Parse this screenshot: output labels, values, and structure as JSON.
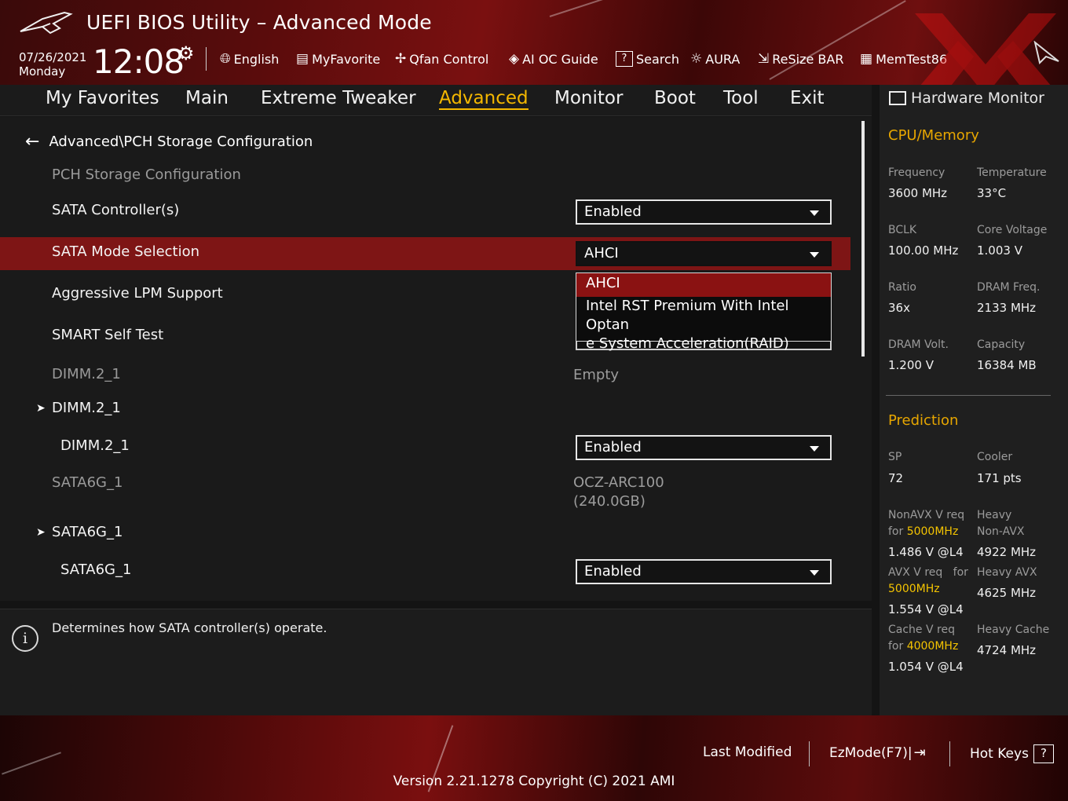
{
  "app": {
    "title": "UEFI BIOS Utility – Advanced Mode",
    "date": "07/26/2021",
    "day": "Monday",
    "time": "12:08"
  },
  "toolbar": [
    {
      "label": "English",
      "icon": "globe-icon"
    },
    {
      "label": "MyFavorite",
      "icon": "favorite-icon"
    },
    {
      "label": "Qfan Control",
      "icon": "fan-icon"
    },
    {
      "label": "AI OC Guide",
      "icon": "ai-guide-icon"
    },
    {
      "label": "Search",
      "icon": "search-icon"
    },
    {
      "label": "AURA",
      "icon": "aura-icon"
    },
    {
      "label": "ReSize BAR",
      "icon": "resize-bar-icon"
    },
    {
      "label": "MemTest86",
      "icon": "memtest-icon"
    }
  ],
  "tabs": [
    "My Favorites",
    "Main",
    "Extreme Tweaker",
    "Advanced",
    "Monitor",
    "Boot",
    "Tool",
    "Exit"
  ],
  "active_tab": "Advanced",
  "breadcrumb": "Advanced\\PCH Storage Configuration",
  "settings": {
    "section_title": "PCH Storage Configuration",
    "sata_controllers": {
      "label": "SATA Controller(s)",
      "value": "Enabled"
    },
    "sata_mode": {
      "label": "SATA Mode Selection",
      "value": "AHCI"
    },
    "aggressive_lpm": {
      "label": "Aggressive LPM Support"
    },
    "smart_self_test": {
      "label": "SMART Self Test"
    },
    "dimm_info": {
      "label": "DIMM.2_1",
      "value": "Empty"
    },
    "dimm_group": {
      "label": "DIMM.2_1"
    },
    "dimm_port": {
      "label": "DIMM.2_1",
      "value": "Enabled"
    },
    "sata_info": {
      "label": "SATA6G_1",
      "value_line1": "OCZ-ARC100",
      "value_line2": "(240.0GB)"
    },
    "sata_group": {
      "label": "SATA6G_1"
    },
    "sata_port": {
      "label": "SATA6G_1",
      "value": "Enabled"
    }
  },
  "dropdown_options": {
    "option1": "AHCI",
    "option2_line1": "Intel RST Premium With Intel Optan",
    "option2_line2": "e System Acceleration(RAID)"
  },
  "help_text": "Determines how SATA controller(s) operate.",
  "hw_monitor": {
    "title": "Hardware Monitor",
    "cpu_memory": {
      "title": "CPU/Memory",
      "frequency": {
        "label": "Frequency",
        "value": "3600 MHz"
      },
      "temperature": {
        "label": "Temperature",
        "value": "33°C"
      },
      "bclk": {
        "label": "BCLK",
        "value": "100.00 MHz"
      },
      "core_voltage": {
        "label": "Core Voltage",
        "value": "1.003 V"
      },
      "ratio": {
        "label": "Ratio",
        "value": "36x"
      },
      "dram_freq": {
        "label": "DRAM Freq.",
        "value": "2133 MHz"
      },
      "dram_volt": {
        "label": "DRAM Volt.",
        "value": "1.200 V"
      },
      "capacity": {
        "label": "Capacity",
        "value": "16384 MB"
      }
    },
    "prediction": {
      "title": "Prediction",
      "sp": {
        "label": "SP",
        "value": "72"
      },
      "cooler": {
        "label": "Cooler",
        "value": "171 pts"
      },
      "nonavx": {
        "label1": "NonAVX V req",
        "label2": "for",
        "freq": "5000MHz",
        "value": "1.486 V @L4"
      },
      "heavy_nonavx": {
        "label1": "Heavy",
        "label2": "Non-AVX",
        "value": "4922 MHz"
      },
      "avx": {
        "label1": "AVX V req",
        "label_for": "for",
        "freq": "5000MHz",
        "value": "1.554 V @L4"
      },
      "heavy_avx": {
        "label": "Heavy AVX",
        "value": "4625 MHz"
      },
      "cache": {
        "label1": "Cache V req",
        "label2": "for",
        "freq": "4000MHz",
        "value": "1.054 V @L4"
      },
      "heavy_cache": {
        "label": "Heavy Cache",
        "value": "4724 MHz"
      }
    }
  },
  "footer": {
    "last_modified": "Last Modified",
    "ezmode": "EzMode(F7)|",
    "hotkeys": "Hot Keys",
    "hotkeys_key": "?",
    "version": "Version 2.21.1278 Copyright (C) 2021 AMI"
  },
  "colors": {
    "accent": "#f5b800",
    "selected_row": "#7e1515",
    "header_red": "#7a1010"
  }
}
